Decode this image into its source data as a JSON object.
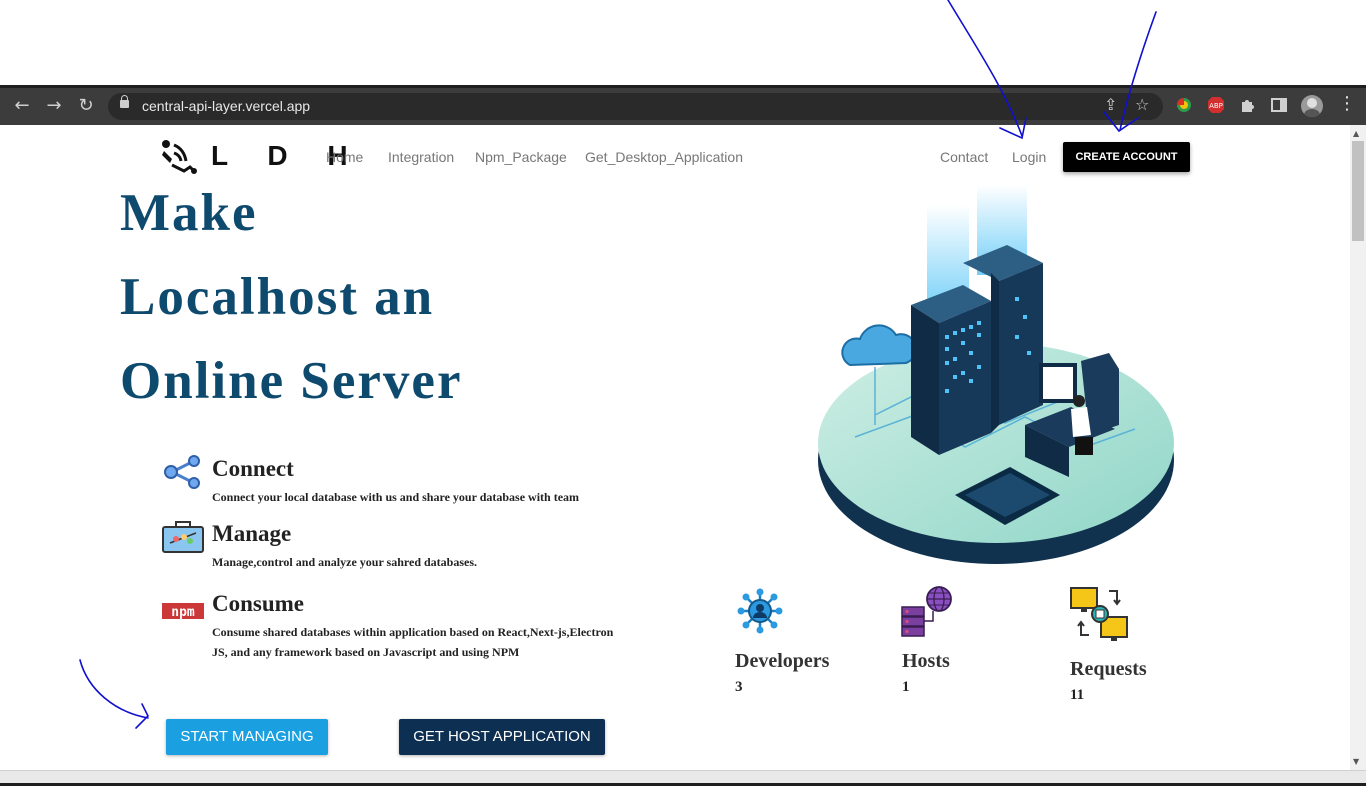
{
  "browser": {
    "url": "central-api-layer.vercel.app",
    "back_icon": "arrow-left-icon",
    "forward_icon": "arrow-right-icon",
    "reload_icon": "reload-icon"
  },
  "header": {
    "brand": "L D H",
    "nav": [
      "Home",
      "Integration",
      "Npm_Package",
      "Get_Desktop_Application"
    ],
    "contact": "Contact",
    "login": "Login",
    "create_account": "CREATE ACCOUNT"
  },
  "hero": {
    "line1": "Make",
    "line2": "Localhost an",
    "line3": "Online Server"
  },
  "features": [
    {
      "title": "Connect",
      "description": "Connect your local database with us and share your database with team",
      "icon": "share-nodes-icon"
    },
    {
      "title": "Manage",
      "description": "Manage,control and analyze your sahred databases.",
      "icon": "toolbox-icon"
    },
    {
      "title": "Consume",
      "description": "Consume shared databases within application based on React,Next-js,Electron JS, and any framework based on Javascript and using NPM",
      "icon": "npm-logo-icon"
    }
  ],
  "buttons": {
    "start": "START MANAGING",
    "host": "GET HOST APPLICATION"
  },
  "stats": [
    {
      "label": "Developers",
      "value": "3",
      "icon": "developer-network-icon"
    },
    {
      "label": "Hosts",
      "value": "1",
      "icon": "server-globe-icon"
    },
    {
      "label": "Requests",
      "value": "11",
      "icon": "request-exchange-icon"
    }
  ],
  "colors": {
    "hero_text": "#0e4a6e",
    "primary_button": "#1a9fe0",
    "secondary_button": "#0d2f52",
    "create_account_bg": "#000000",
    "annotation_pen": "#1010d0"
  }
}
